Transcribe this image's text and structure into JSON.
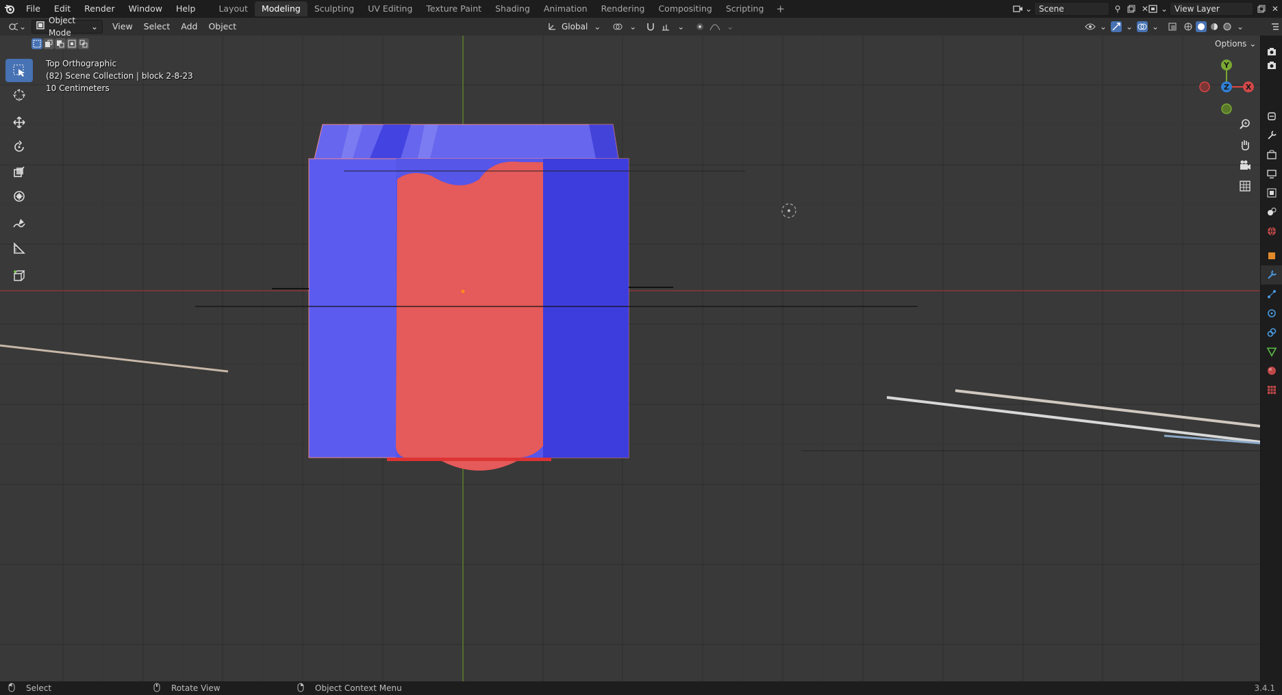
{
  "topbar": {
    "menus": [
      "File",
      "Edit",
      "Render",
      "Window",
      "Help"
    ],
    "workspaces": [
      "Layout",
      "Modeling",
      "Sculpting",
      "UV Editing",
      "Texture Paint",
      "Shading",
      "Animation",
      "Rendering",
      "Compositing",
      "Scripting"
    ],
    "active_workspace": "Modeling",
    "add_tab_icon": "plus-icon",
    "scene_name": "Scene",
    "view_layer_name": "View Layer"
  },
  "header": {
    "mode": "Object Mode",
    "menus": [
      "View",
      "Select",
      "Add",
      "Object"
    ],
    "transform_orientation": "Global",
    "options_label": "Options"
  },
  "viewport": {
    "view_name": "Top Orthographic",
    "collection_info": "(82) Scene Collection | block 2-8-23",
    "scale_info": "10 Centimeters",
    "gizmo_axes": [
      "Y",
      "Z",
      "X"
    ]
  },
  "statusbar": {
    "items": [
      "Select",
      "Rotate View",
      "Object Context Menu"
    ],
    "version": "3.4.1"
  },
  "colors": {
    "accent": "#4772b3",
    "blue_object": "#5b5bf0",
    "red_object": "#e55a5a",
    "x_axis": "#c43c3c",
    "y_axis": "#6a9a2a",
    "z_axis": "#2f7fd4"
  }
}
